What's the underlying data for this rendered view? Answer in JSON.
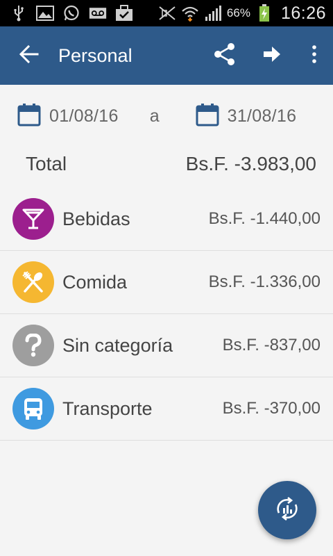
{
  "status_bar": {
    "battery_percent": "66%",
    "time": "16:26",
    "icons": [
      "usb-icon",
      "gallery-icon",
      "whatsapp-icon",
      "voicemail-icon",
      "briefcase-icon",
      "mute-icon",
      "wifi-icon",
      "signal-icon",
      "battery-charging-icon"
    ]
  },
  "appbar": {
    "title": "Personal",
    "icons": [
      "back-arrow-icon",
      "share-icon",
      "forward-arrow-icon",
      "more-vert-icon"
    ],
    "color": "#2e5a8a"
  },
  "date_range": {
    "from": "01/08/16",
    "separator": "a",
    "to": "31/08/16"
  },
  "total": {
    "label": "Total",
    "value": "Bs.F. -3.983,00"
  },
  "categories": [
    {
      "name": "Bebidas",
      "amount": "Bs.F. -1.440,00",
      "icon": "cocktail-icon",
      "color": "#9c1f8e"
    },
    {
      "name": "Comida",
      "amount": "Bs.F. -1.336,00",
      "icon": "fork-spoon-icon",
      "color": "#f5b731"
    },
    {
      "name": "Sin categoría",
      "amount": "Bs.F. -837,00",
      "icon": "question-icon",
      "color": "#9e9e9e"
    },
    {
      "name": "Transporte",
      "amount": "Bs.F. -370,00",
      "icon": "bus-icon",
      "color": "#3f9ae0"
    }
  ],
  "fab": {
    "icon": "chart-refresh-icon"
  }
}
